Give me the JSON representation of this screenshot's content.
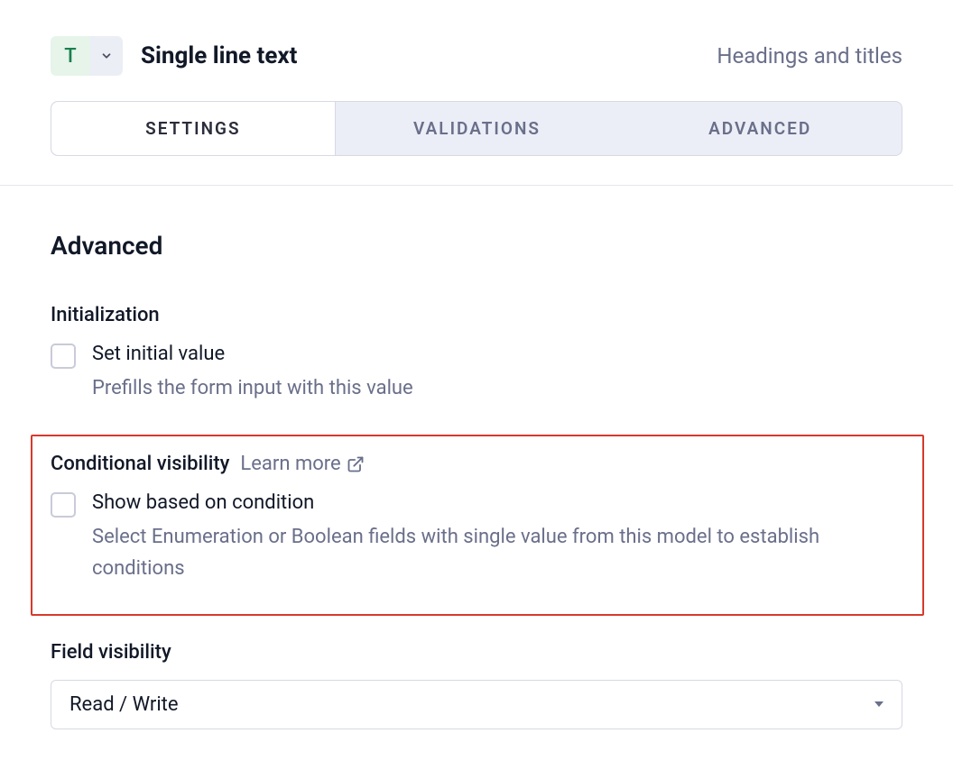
{
  "header": {
    "type_icon_letter": "T",
    "field_type_title": "Single line text",
    "context_label": "Headings and titles"
  },
  "tabs": {
    "settings": "SETTINGS",
    "validations": "VALIDATIONS",
    "advanced": "ADVANCED"
  },
  "section": {
    "title": "Advanced"
  },
  "initialization": {
    "label": "Initialization",
    "checkbox_label": "Set initial value",
    "checkbox_desc": "Prefills the form input with this value"
  },
  "conditional": {
    "label": "Conditional visibility",
    "learn_more": "Learn more",
    "checkbox_label": "Show based on condition",
    "checkbox_desc": "Select Enumeration or Boolean fields with single value from this model to establish conditions"
  },
  "field_visibility": {
    "label": "Field visibility",
    "selected": "Read / Write"
  }
}
